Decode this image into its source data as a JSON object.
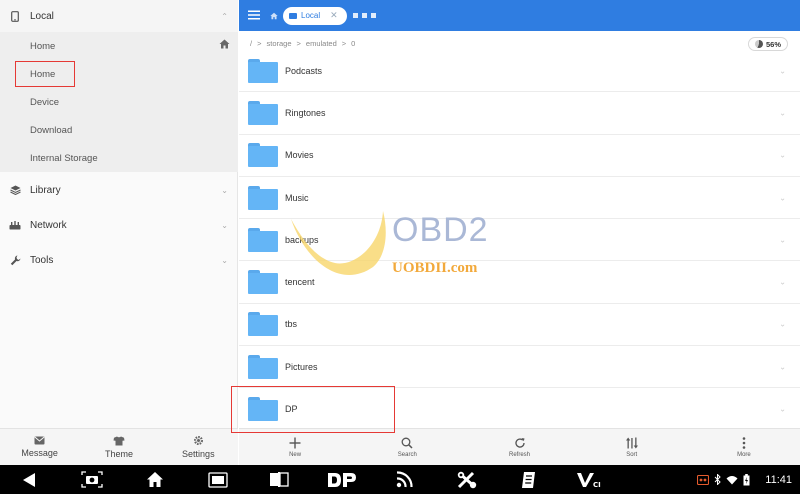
{
  "sidebar": {
    "local": {
      "label": "Local",
      "icon": "phone-icon"
    },
    "local_items": [
      {
        "label": "Home",
        "icon": "house-icon"
      },
      {
        "label": "Home"
      },
      {
        "label": "Device"
      },
      {
        "label": "Download"
      },
      {
        "label": "Internal Storage"
      }
    ],
    "library": {
      "label": "Library",
      "icon": "stack-icon"
    },
    "network": {
      "label": "Network",
      "icon": "network-icon"
    },
    "tools": {
      "label": "Tools",
      "icon": "wrench-icon"
    },
    "bottom": [
      {
        "label": "Message",
        "icon": "message-icon"
      },
      {
        "label": "Theme",
        "icon": "shirt-icon"
      },
      {
        "label": "Settings",
        "icon": "gear-icon"
      }
    ]
  },
  "appbar": {
    "tab_label": "Local",
    "accent": "#2f7de1"
  },
  "path": {
    "root": "/",
    "crumbs": [
      "storage",
      "emulated",
      "0"
    ],
    "storage_percent": "56%"
  },
  "files": [
    {
      "name": "Podcasts"
    },
    {
      "name": "Ringtones"
    },
    {
      "name": "Movies"
    },
    {
      "name": "Music"
    },
    {
      "name": "backups"
    },
    {
      "name": "tencent"
    },
    {
      "name": "tbs"
    },
    {
      "name": "Pictures"
    },
    {
      "name": "DP"
    }
  ],
  "toolbar": [
    {
      "label": "New",
      "icon": "plus-icon"
    },
    {
      "label": "Search",
      "icon": "search-icon"
    },
    {
      "label": "Refresh",
      "icon": "refresh-icon"
    },
    {
      "label": "Sort",
      "icon": "sort-icon"
    },
    {
      "label": "More",
      "icon": "more-vert-icon"
    }
  ],
  "watermark": {
    "brand": "OBD2",
    "site": "UOBDII.com"
  },
  "system": {
    "time": "11:41"
  }
}
